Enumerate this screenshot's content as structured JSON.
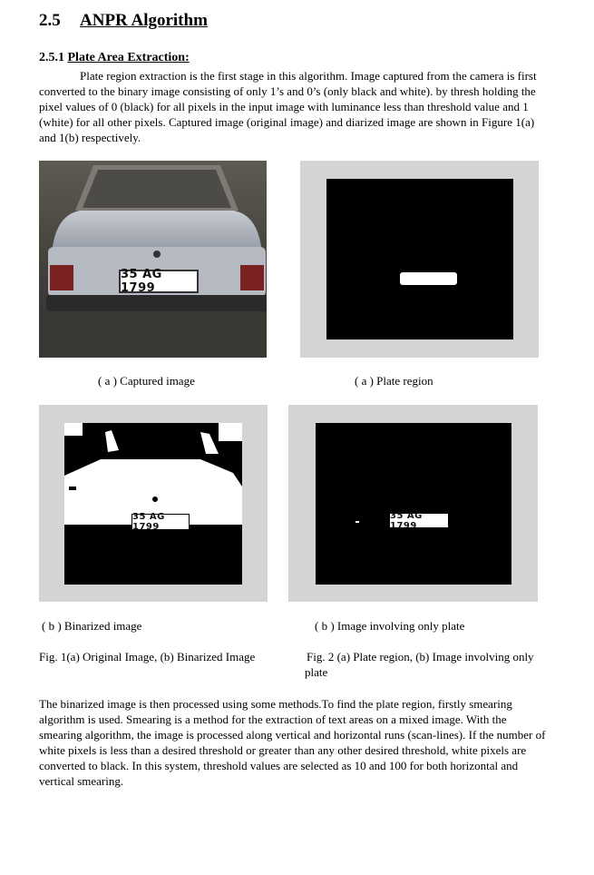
{
  "section": {
    "number": "2.5",
    "title": "ANPR Algorithm"
  },
  "subsection": {
    "number": "2.5.1",
    "title": "Plate Area Extraction:"
  },
  "para1": "Plate region extraction is the first stage in this algorithm. Image captured from the camera is first converted to the binary image consisting of only 1’s and 0’s (only black and white). by thresh holding the pixel values of 0 (black) for all pixels in the input image with luminance less than threshold value and 1 (white) for all other pixels. Captured image (original image) and diarized image are shown in Figure 1(a) and 1(b) respectively.",
  "figures": {
    "plate_text": "35 AG 1799",
    "cap_a_left": "( a ) Captured image",
    "cap_a_right": "( a ) Plate region",
    "cap_b_left": "( b ) Binarized image",
    "cap_b_right": "( b ) Image involving only plate",
    "fig1_caption": "Fig. 1(a) Original Image, (b) Binarized Image",
    "fig2_caption": "Fig. 2 (a) Plate region, (b) Image involving only plate"
  },
  "para2": "The binarized image is then processed using some methods.To find the plate region, firstly smearing algorithm is used. Smearing is a method for the extraction of text areas on a mixed image. With the smearing algorithm, the image is processed along vertical and horizontal runs (scan-lines). If the number of white pixels is less than a desired threshold or greater than any other desired threshold, white pixels are converted to black. In this system, threshold values are selected as 10 and 100 for both horizontal and vertical smearing."
}
